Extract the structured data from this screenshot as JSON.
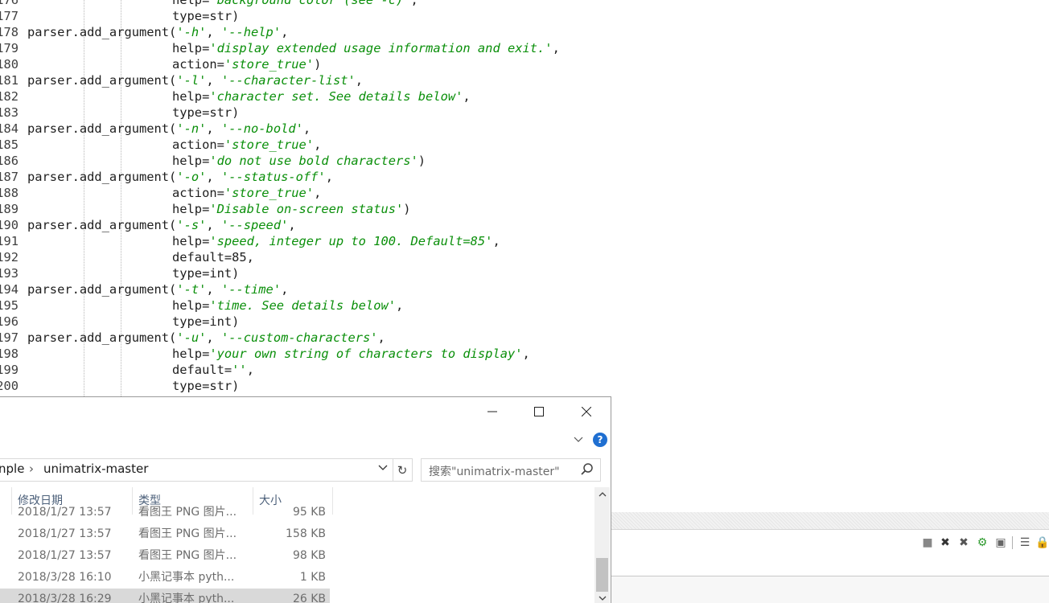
{
  "editor": {
    "lines": [
      {
        "n": "176",
        "indent": true,
        "pre": "help=",
        "str": "'background color (see -c)'",
        "post": ","
      },
      {
        "n": "177",
        "indent": true,
        "pre": "type=str)",
        "str": "",
        "post": ""
      },
      {
        "n": "178",
        "indent": false,
        "pre": "parser.add_argument(",
        "str": "'-h'",
        "post": ", ",
        "str2": "'--help'",
        "post2": ","
      },
      {
        "n": "179",
        "indent": true,
        "pre": "help=",
        "str": "'display extended usage information and exit.'",
        "post": ","
      },
      {
        "n": "180",
        "indent": true,
        "pre": "action=",
        "str": "'store_true'",
        "post": ")"
      },
      {
        "n": "181",
        "indent": false,
        "pre": "parser.add_argument(",
        "str": "'-l'",
        "post": ", ",
        "str2": "'--character-list'",
        "post2": ","
      },
      {
        "n": "182",
        "indent": true,
        "pre": "help=",
        "str": "'character set. See details below'",
        "post": ","
      },
      {
        "n": "183",
        "indent": true,
        "pre": "type=str)",
        "str": "",
        "post": ""
      },
      {
        "n": "184",
        "indent": false,
        "pre": "parser.add_argument(",
        "str": "'-n'",
        "post": ", ",
        "str2": "'--no-bold'",
        "post2": ","
      },
      {
        "n": "185",
        "indent": true,
        "pre": "action=",
        "str": "'store_true'",
        "post": ","
      },
      {
        "n": "186",
        "indent": true,
        "pre": "help=",
        "str": "'do not use bold characters'",
        "post": ")"
      },
      {
        "n": "187",
        "indent": false,
        "pre": "parser.add_argument(",
        "str": "'-o'",
        "post": ", ",
        "str2": "'--status-off'",
        "post2": ","
      },
      {
        "n": "188",
        "indent": true,
        "pre": "action=",
        "str": "'store_true'",
        "post": ","
      },
      {
        "n": "189",
        "indent": true,
        "pre": "help=",
        "str": "'Disable on-screen status'",
        "post": ")"
      },
      {
        "n": "190",
        "indent": false,
        "pre": "parser.add_argument(",
        "str": "'-s'",
        "post": ", ",
        "str2": "'--speed'",
        "post2": ","
      },
      {
        "n": "191",
        "indent": true,
        "pre": "help=",
        "str": "'speed, integer up to 100. Default=85'",
        "post": ","
      },
      {
        "n": "192",
        "indent": true,
        "pre": "default=85,",
        "str": "",
        "post": ""
      },
      {
        "n": "193",
        "indent": true,
        "pre": "type=int)",
        "str": "",
        "post": ""
      },
      {
        "n": "194",
        "indent": false,
        "pre": "parser.add_argument(",
        "str": "'-t'",
        "post": ", ",
        "str2": "'--time'",
        "post2": ","
      },
      {
        "n": "195",
        "indent": true,
        "pre": "help=",
        "str": "'time. See details below'",
        "post": ","
      },
      {
        "n": "196",
        "indent": true,
        "pre": "type=int)",
        "str": "",
        "post": ""
      },
      {
        "n": "197",
        "indent": false,
        "pre": "parser.add_argument(",
        "str": "'-u'",
        "post": ", ",
        "str2": "'--custom-characters'",
        "post2": ","
      },
      {
        "n": "198",
        "indent": true,
        "pre": "help=",
        "str": "'your own string of characters to display'",
        "post": ","
      },
      {
        "n": "199",
        "indent": true,
        "pre": "default=",
        "str": "''",
        "post": ","
      },
      {
        "n": "200",
        "indent": true,
        "pre": "type=str)",
        "str": "",
        "post": ""
      }
    ]
  },
  "explorer": {
    "window_controls": {
      "minimize": "—",
      "maximize": "☐",
      "close": "✕"
    },
    "help_label": "?",
    "breadcrumb": {
      "parent_partial": "nple",
      "separator": "›",
      "current": "unimatrix-master"
    },
    "search_placeholder": "搜索\"unimatrix-master\"",
    "columns": {
      "date": "修改日期",
      "type": "类型",
      "size": "大小"
    },
    "rows": [
      {
        "date": "2018/1/27 13:57",
        "type": "看图王 PNG 图片...",
        "size": "95 KB"
      },
      {
        "date": "2018/1/27 13:57",
        "type": "看图王 PNG 图片...",
        "size": "158 KB"
      },
      {
        "date": "2018/1/27 13:57",
        "type": "看图王 PNG 图片...",
        "size": "98 KB"
      },
      {
        "date": "2018/3/28 16:10",
        "type": "小黑记事本 pyth...",
        "size": "1 KB"
      },
      {
        "date": "2018/3/28 16:29",
        "type": "小黑记事本 pyth...",
        "size": "26 KB"
      }
    ]
  },
  "side_toolbar": {
    "icons": [
      "stop-icon",
      "close-x-icon",
      "close-all-icon",
      "gear-run-icon",
      "window-icon",
      "list-icon",
      "lock-icon"
    ]
  },
  "colors": {
    "string": "#0a8f0a",
    "help_badge": "#1f6fd1",
    "selected_row": "#d9d9d9"
  }
}
